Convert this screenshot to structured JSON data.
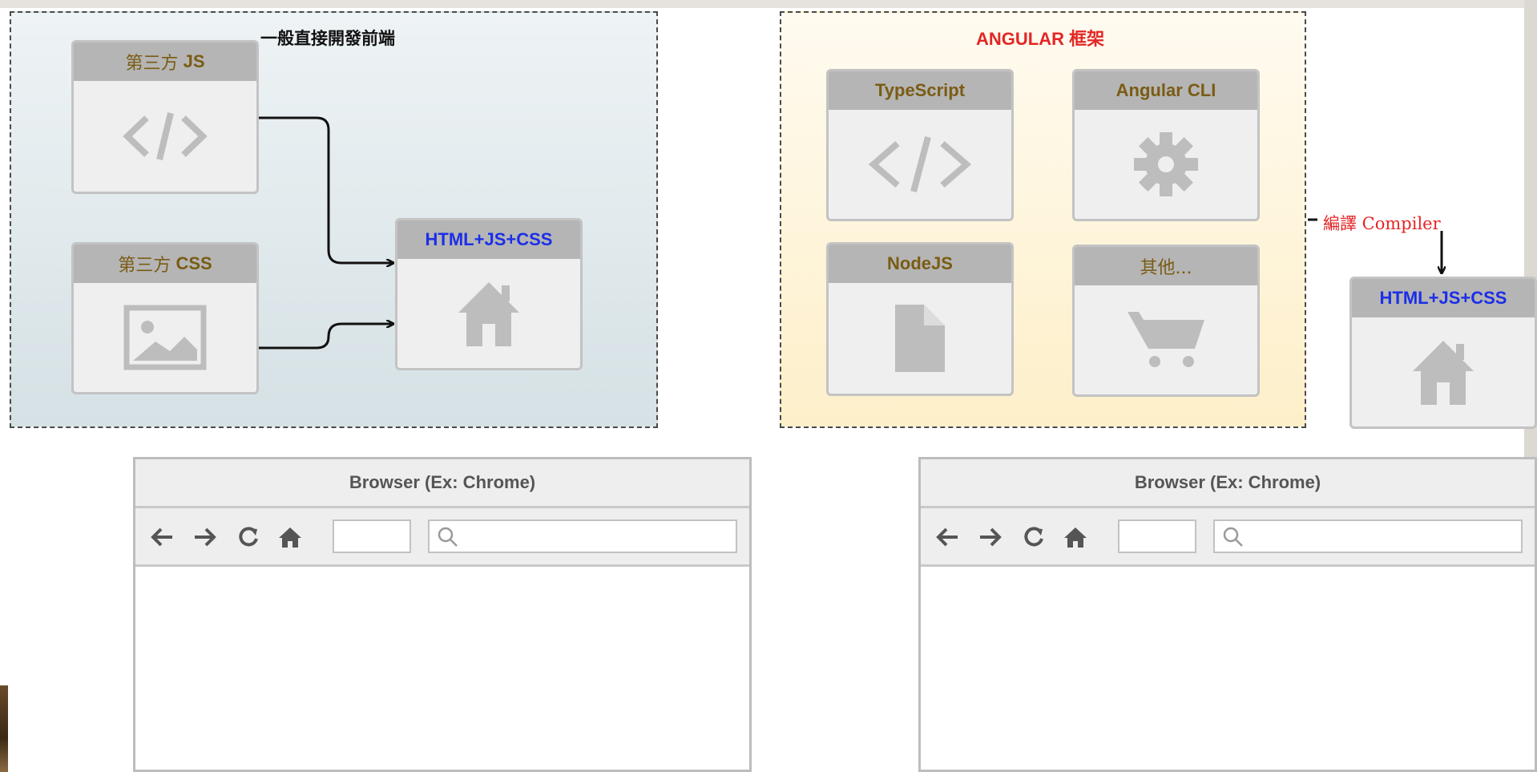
{
  "groups": {
    "left_label": "一般直接開發前端",
    "right_label": "ANGULAR 框架",
    "compiler_label": "編譯 Compiler"
  },
  "boxes": {
    "js": {
      "prefix": "第三方",
      "suffix": "JS",
      "icon": "code-icon"
    },
    "css": {
      "prefix": "第三方",
      "suffix": "CSS",
      "icon": "image-icon"
    },
    "output_left": {
      "title": "HTML+JS+CSS",
      "icon": "home-icon"
    },
    "typescript": {
      "title": "TypeScript",
      "icon": "code-icon"
    },
    "angular_cli": {
      "title": "Angular CLI",
      "icon": "gear-icon"
    },
    "nodejs": {
      "title": "NodeJS",
      "icon": "file-icon"
    },
    "other": {
      "title": "其他...",
      "icon": "cart-icon"
    },
    "output_right": {
      "title": "HTML+JS+CSS",
      "icon": "home-icon"
    }
  },
  "browsers": {
    "left": {
      "title": "Browser (Ex: Chrome)"
    },
    "right": {
      "title": "Browser (Ex: Chrome)"
    }
  },
  "colors": {
    "header_text": "#7a5c14",
    "output_text": "#1c2ee8",
    "red_label": "#e32626",
    "icon_gray": "#bdbdbd"
  }
}
